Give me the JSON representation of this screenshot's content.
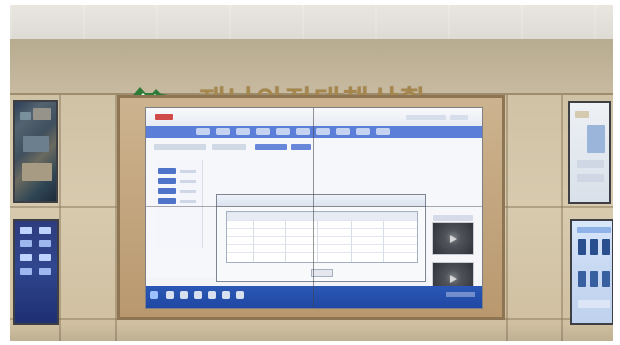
{
  "sign": {
    "title": "재난안전대책상황"
  },
  "colors": {
    "wood": "#c9b18a",
    "sign_text": "#a5874e",
    "screen_blue": "#5b7ed9",
    "taskbar_blue": "#2b58b6"
  }
}
